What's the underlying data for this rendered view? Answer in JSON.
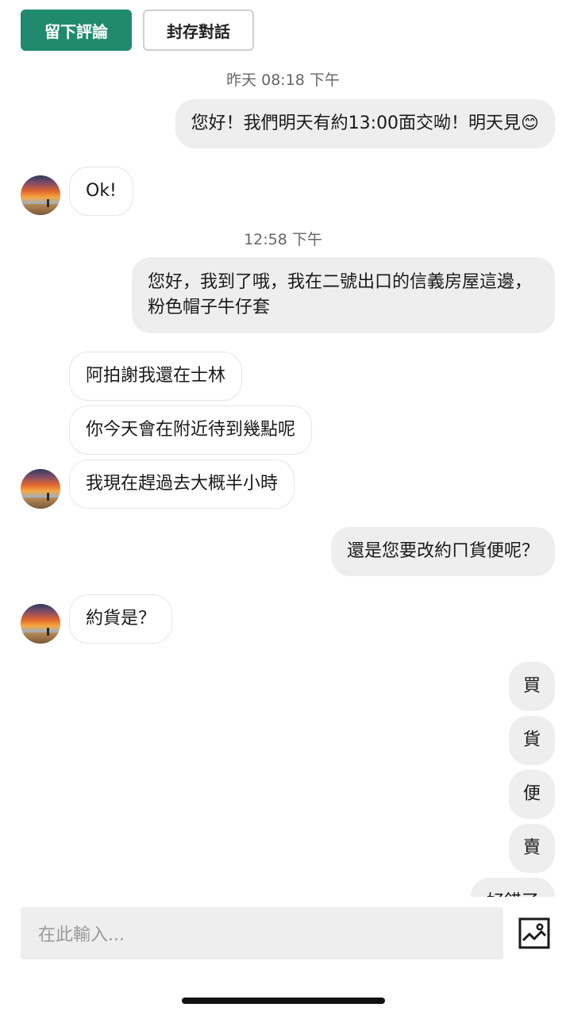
{
  "header": {
    "review_label": "留下評論",
    "archive_label": "封存對話"
  },
  "timestamps": {
    "t1": "昨天 08:18 下午",
    "t2": "12:58 下午"
  },
  "messages": {
    "m1": "您好！我們明天有約13:00面交呦！明天見😊",
    "m2": "Ok!",
    "m3": "您好，我到了哦，我在二號出口的信義房屋這邊，粉色帽子牛仔套",
    "m4": "阿拍謝我還在士林",
    "m5": "你今天會在附近待到幾點呢",
    "m6": "我現在趕過去大概半小時",
    "m7": "還是您要改約ㄇ貨便呢？",
    "m8": "約貨是？",
    "m9": "買",
    "m10": "貨",
    "m11": "便",
    "m12": "賣",
    "m13": "好錯了"
  },
  "composer": {
    "placeholder": "在此輸入..."
  },
  "colors": {
    "primary": "#1f8a6e",
    "outgoing_bubble": "#eeeeee",
    "incoming_border": "#e6e6e6"
  },
  "icons": {
    "image_upload": "image-icon",
    "avatar": "user-avatar"
  }
}
